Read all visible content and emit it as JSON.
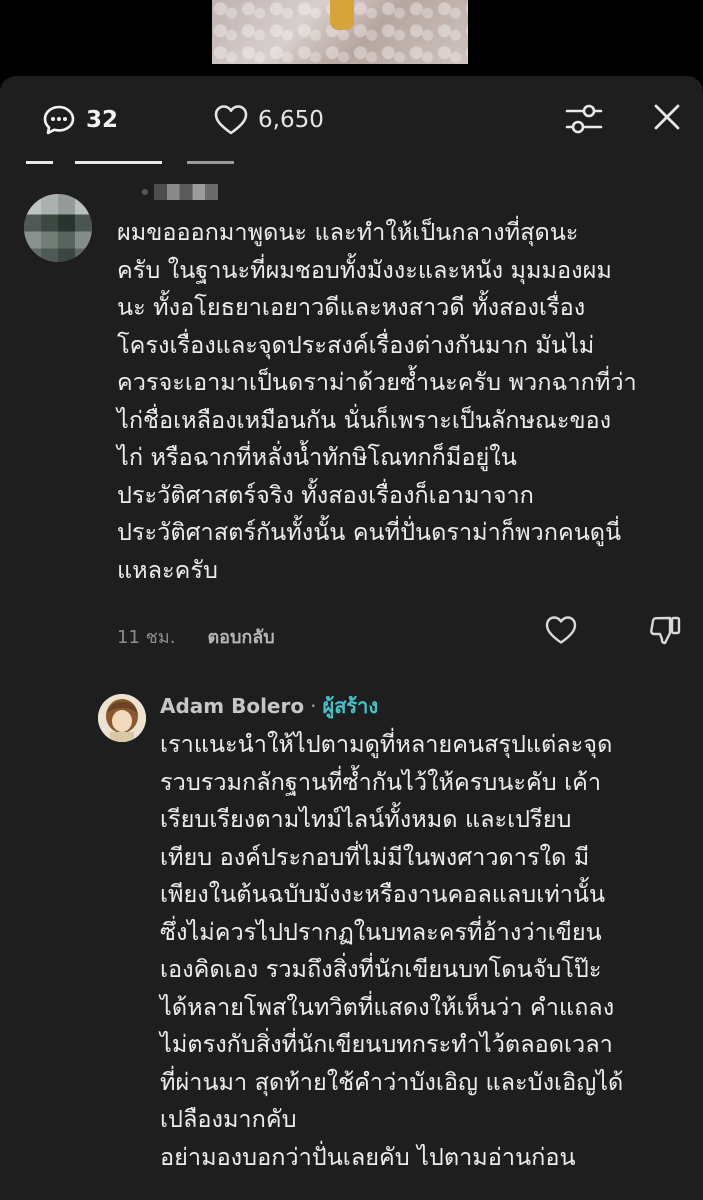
{
  "header": {
    "comment_count": "32",
    "like_count": "6,650"
  },
  "comments": [
    {
      "time": "11 ชม.",
      "reply_label": "ตอบกลับ",
      "lines": [
        "ผมขอออกมาพูดนะ และทำให้เป็นกลางที่สุดนะ",
        "ครับ ในฐานะที่ผมชอบทั้งมังงะและหนัง มุมมองผม",
        "นะ ทั้งอโยธยาเอยาวดีและหงสาวดี ทั้งสองเรื่อง",
        "โครงเรื่องและจุดประสงค์เรื่องต่างกันมาก มันไม่",
        "ควรจะเอามาเป็นดราม่าด้วยซ้ำนะครับ พวกฉากที่ว่า",
        "ไก่ชื่อเหลืองเหมือนกัน นั่นก็เพราะเป็นลักษณะของ",
        "ไก่ หรือฉากที่หลั่งน้ำทักษิโณทกก็มีอยู่ใน",
        "ประวัติศาสตร์จริง ทั้งสองเรื่องก็เอามาจาก",
        "ประวัติศาสตร์กันทั้งนั้น คนที่ปั่นดราม่าก็พวกคนดูนี่",
        "แหละครับ"
      ]
    }
  ],
  "reply": {
    "author": "Adam Bolero",
    "separator": "·",
    "badge": "ผู้สร้าง",
    "lines": [
      "เราแนะนำให้ไปตามดูที่หลายคนสรุปแต่ละจุด",
      "รวบรวมกลักฐานที่ซ้ำกันไว้ให้ครบนะคับ เค้า",
      "เรียบเรียงตามไทม์ไลน์ทั้งหมด และเปรียบ",
      "เทียบ องค์ประกอบที่ไม่มีในพงศาวดารใด มี",
      "เพียงในต้นฉบับมังงะหรืองานคอลแลบเท่านั้น",
      "ซึ่งไม่ควรไปปรากฏในบทละครที่อ้างว่าเขียน",
      "เองคิดเอง รวมถึงสิ่งที่นักเขียนบทโดนจับโป๊ะ",
      "ได้หลายโพสในทวิตที่แสดงให้เห็นว่า คำแถลง",
      "ไม่ตรงกับสิ่งที่นักเขียนบทกระทำไว้ตลอดเวลา",
      "ที่ผ่านมา สุดท้ายใช้คำว่าบังเอิญ และบังเอิญได้",
      "เปลืองมากคับ",
      "อย่ามองบอกว่าปั่นเลยคับ ไปตามอ่านก่อน"
    ]
  },
  "icons": {
    "comments": "speech-bubble-icon",
    "likes": "heart-icon",
    "filter": "sliders-icon",
    "close": "close-icon",
    "like": "heart-outline-icon",
    "dislike": "thumbs-down-icon"
  },
  "colors": {
    "sheet_bg": "#1e1e1e",
    "creator_badge": "#3fc3c8"
  }
}
